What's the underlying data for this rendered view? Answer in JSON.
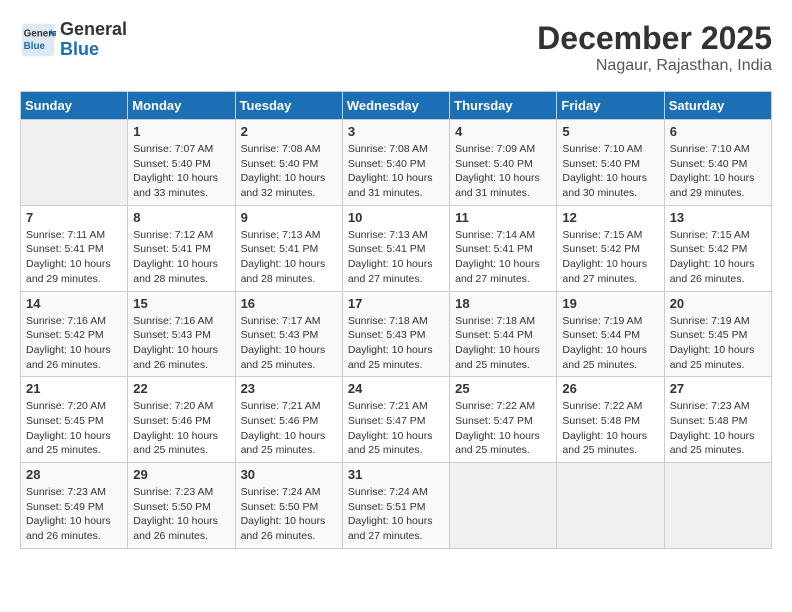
{
  "header": {
    "logo_line1": "General",
    "logo_line2": "Blue",
    "month": "December 2025",
    "location": "Nagaur, Rajasthan, India"
  },
  "days_of_week": [
    "Sunday",
    "Monday",
    "Tuesday",
    "Wednesday",
    "Thursday",
    "Friday",
    "Saturday"
  ],
  "weeks": [
    [
      {
        "day": "",
        "info": ""
      },
      {
        "day": "1",
        "info": "Sunrise: 7:07 AM\nSunset: 5:40 PM\nDaylight: 10 hours\nand 33 minutes."
      },
      {
        "day": "2",
        "info": "Sunrise: 7:08 AM\nSunset: 5:40 PM\nDaylight: 10 hours\nand 32 minutes."
      },
      {
        "day": "3",
        "info": "Sunrise: 7:08 AM\nSunset: 5:40 PM\nDaylight: 10 hours\nand 31 minutes."
      },
      {
        "day": "4",
        "info": "Sunrise: 7:09 AM\nSunset: 5:40 PM\nDaylight: 10 hours\nand 31 minutes."
      },
      {
        "day": "5",
        "info": "Sunrise: 7:10 AM\nSunset: 5:40 PM\nDaylight: 10 hours\nand 30 minutes."
      },
      {
        "day": "6",
        "info": "Sunrise: 7:10 AM\nSunset: 5:40 PM\nDaylight: 10 hours\nand 29 minutes."
      }
    ],
    [
      {
        "day": "7",
        "info": "Sunrise: 7:11 AM\nSunset: 5:41 PM\nDaylight: 10 hours\nand 29 minutes."
      },
      {
        "day": "8",
        "info": "Sunrise: 7:12 AM\nSunset: 5:41 PM\nDaylight: 10 hours\nand 28 minutes."
      },
      {
        "day": "9",
        "info": "Sunrise: 7:13 AM\nSunset: 5:41 PM\nDaylight: 10 hours\nand 28 minutes."
      },
      {
        "day": "10",
        "info": "Sunrise: 7:13 AM\nSunset: 5:41 PM\nDaylight: 10 hours\nand 27 minutes."
      },
      {
        "day": "11",
        "info": "Sunrise: 7:14 AM\nSunset: 5:41 PM\nDaylight: 10 hours\nand 27 minutes."
      },
      {
        "day": "12",
        "info": "Sunrise: 7:15 AM\nSunset: 5:42 PM\nDaylight: 10 hours\nand 27 minutes."
      },
      {
        "day": "13",
        "info": "Sunrise: 7:15 AM\nSunset: 5:42 PM\nDaylight: 10 hours\nand 26 minutes."
      }
    ],
    [
      {
        "day": "14",
        "info": "Sunrise: 7:16 AM\nSunset: 5:42 PM\nDaylight: 10 hours\nand 26 minutes."
      },
      {
        "day": "15",
        "info": "Sunrise: 7:16 AM\nSunset: 5:43 PM\nDaylight: 10 hours\nand 26 minutes."
      },
      {
        "day": "16",
        "info": "Sunrise: 7:17 AM\nSunset: 5:43 PM\nDaylight: 10 hours\nand 25 minutes."
      },
      {
        "day": "17",
        "info": "Sunrise: 7:18 AM\nSunset: 5:43 PM\nDaylight: 10 hours\nand 25 minutes."
      },
      {
        "day": "18",
        "info": "Sunrise: 7:18 AM\nSunset: 5:44 PM\nDaylight: 10 hours\nand 25 minutes."
      },
      {
        "day": "19",
        "info": "Sunrise: 7:19 AM\nSunset: 5:44 PM\nDaylight: 10 hours\nand 25 minutes."
      },
      {
        "day": "20",
        "info": "Sunrise: 7:19 AM\nSunset: 5:45 PM\nDaylight: 10 hours\nand 25 minutes."
      }
    ],
    [
      {
        "day": "21",
        "info": "Sunrise: 7:20 AM\nSunset: 5:45 PM\nDaylight: 10 hours\nand 25 minutes."
      },
      {
        "day": "22",
        "info": "Sunrise: 7:20 AM\nSunset: 5:46 PM\nDaylight: 10 hours\nand 25 minutes."
      },
      {
        "day": "23",
        "info": "Sunrise: 7:21 AM\nSunset: 5:46 PM\nDaylight: 10 hours\nand 25 minutes."
      },
      {
        "day": "24",
        "info": "Sunrise: 7:21 AM\nSunset: 5:47 PM\nDaylight: 10 hours\nand 25 minutes."
      },
      {
        "day": "25",
        "info": "Sunrise: 7:22 AM\nSunset: 5:47 PM\nDaylight: 10 hours\nand 25 minutes."
      },
      {
        "day": "26",
        "info": "Sunrise: 7:22 AM\nSunset: 5:48 PM\nDaylight: 10 hours\nand 25 minutes."
      },
      {
        "day": "27",
        "info": "Sunrise: 7:23 AM\nSunset: 5:48 PM\nDaylight: 10 hours\nand 25 minutes."
      }
    ],
    [
      {
        "day": "28",
        "info": "Sunrise: 7:23 AM\nSunset: 5:49 PM\nDaylight: 10 hours\nand 26 minutes."
      },
      {
        "day": "29",
        "info": "Sunrise: 7:23 AM\nSunset: 5:50 PM\nDaylight: 10 hours\nand 26 minutes."
      },
      {
        "day": "30",
        "info": "Sunrise: 7:24 AM\nSunset: 5:50 PM\nDaylight: 10 hours\nand 26 minutes."
      },
      {
        "day": "31",
        "info": "Sunrise: 7:24 AM\nSunset: 5:51 PM\nDaylight: 10 hours\nand 27 minutes."
      },
      {
        "day": "",
        "info": ""
      },
      {
        "day": "",
        "info": ""
      },
      {
        "day": "",
        "info": ""
      }
    ]
  ]
}
